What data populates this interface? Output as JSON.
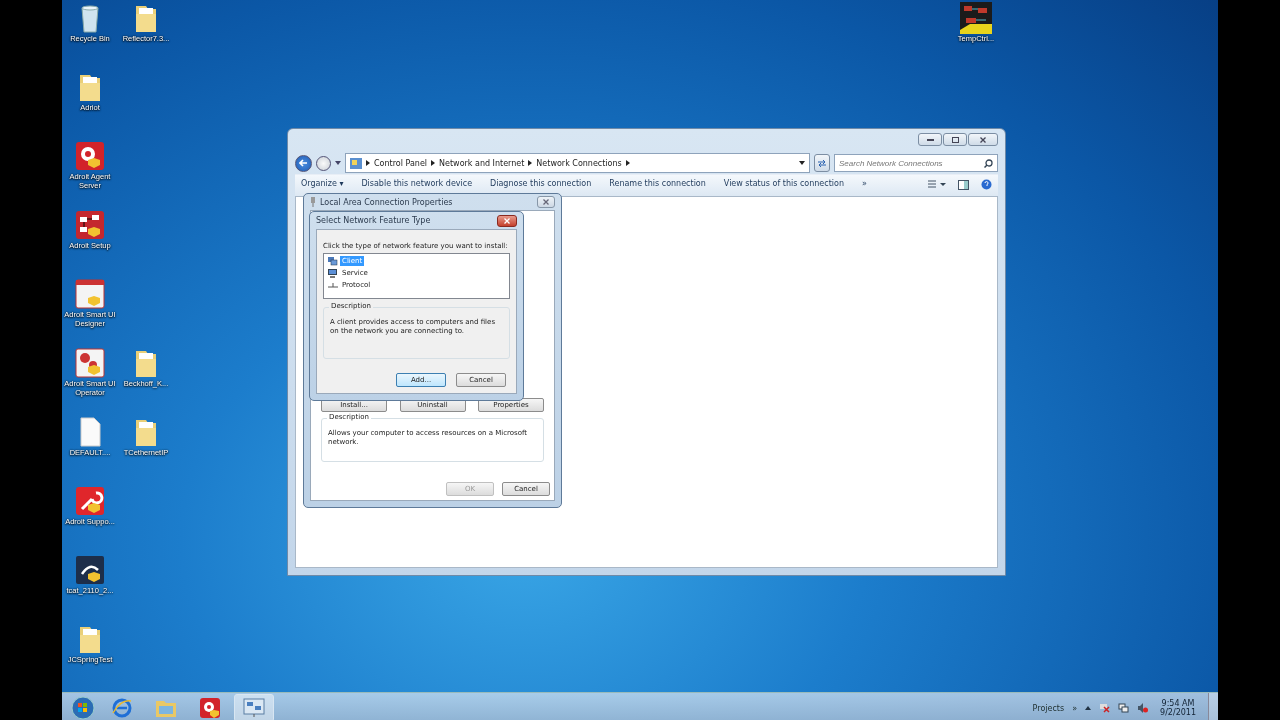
{
  "desktop_icon_rows": [
    [
      {
        "label": "Recycle Bin",
        "kind": "recycle"
      },
      {
        "label": "Reflector7.3...",
        "kind": "folder"
      }
    ],
    [
      {
        "label": "Adriot",
        "kind": "folder"
      }
    ],
    [
      {
        "label": "Adroit Agent Server",
        "kind": "gear"
      }
    ],
    [
      {
        "label": "Adroit Setup",
        "kind": "setup"
      }
    ],
    [
      {
        "label": "Adroit Smart UI Designer",
        "kind": "designer"
      }
    ],
    [
      {
        "label": "Adroit Smart UI Operator",
        "kind": "operator"
      },
      {
        "label": "Beckhoff_K...",
        "kind": "folder"
      }
    ],
    [
      {
        "label": "DEFAULT....",
        "kind": "document"
      },
      {
        "label": "TCethernetIP",
        "kind": "folder"
      }
    ],
    [
      {
        "label": "Adroit Suppo...",
        "kind": "wrench"
      }
    ],
    [
      {
        "label": "tcat_2110_2...",
        "kind": "tcat"
      }
    ],
    [
      {
        "label": "JCSpringTest",
        "kind": "folder"
      }
    ]
  ],
  "desktop_icons_right": [
    {
      "label": "TempCtrl...",
      "kind": "matrix"
    }
  ],
  "explorer": {
    "breadcrumb": [
      "Control Panel",
      "Network and Internet",
      "Network Connections"
    ],
    "search": {
      "placeholder": "Search Network Connections"
    },
    "toolbar": [
      "Organize ▾",
      "Disable this network device",
      "Diagnose this connection",
      "Rename this connection",
      "View status of this connection",
      "»"
    ]
  },
  "properties_dialog": {
    "title": "Local Area Connection Properties",
    "buttons": [
      {
        "label": "Install...",
        "disabled": false
      },
      {
        "label": "Uninstall",
        "disabled": false
      },
      {
        "label": "Properties",
        "disabled": false
      }
    ],
    "description_title": "Description",
    "description": "Allows your computer to access resources on a Microsoft network.",
    "footer_buttons": [
      {
        "label": "OK",
        "disabled": true
      },
      {
        "label": "Cancel",
        "disabled": false
      }
    ]
  },
  "feature_dialog": {
    "title": "Select Network Feature Type",
    "prompt": "Click the type of network feature you want to install:",
    "items": [
      {
        "label": "Client",
        "kind": "client",
        "selected": true
      },
      {
        "label": "Service",
        "kind": "service",
        "selected": false
      },
      {
        "label": "Protocol",
        "kind": "protocol",
        "selected": false
      }
    ],
    "description_title": "Description",
    "description": "A client provides access to computers and files on the network you are connecting to.",
    "buttons": [
      {
        "label": "Add...",
        "selected": true
      },
      {
        "label": "Cancel",
        "selected": false
      }
    ]
  },
  "taskbar": {
    "apps": [
      {
        "kind": "ie",
        "selected": false
      },
      {
        "kind": "explorer",
        "selected": false
      },
      {
        "kind": "gear",
        "selected": false
      },
      {
        "kind": "network",
        "selected": true
      }
    ],
    "toolbar_label": "Projects",
    "chevron": "»",
    "time": "9:54 AM",
    "date": "9/2/2011"
  }
}
